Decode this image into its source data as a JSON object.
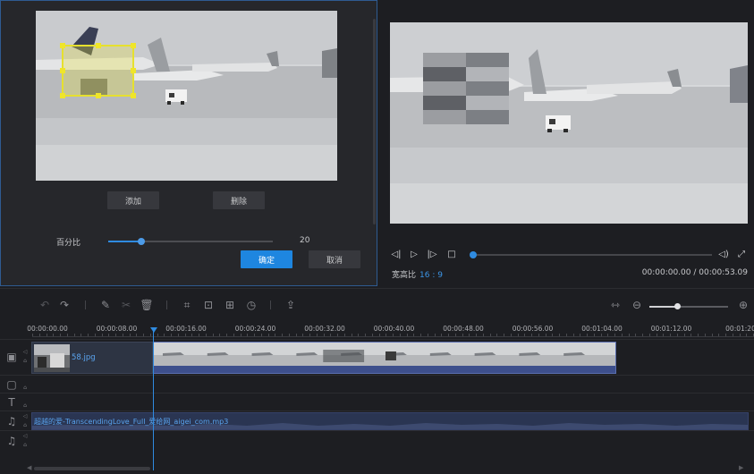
{
  "dialog": {
    "add_label": "添加",
    "delete_label": "删除",
    "percent_label": "百分比",
    "percent_value": "20",
    "percent_fraction": 0.2,
    "confirm_label": "确定",
    "cancel_label": "取消"
  },
  "player": {
    "aspect_label": "宽高比",
    "aspect_value": "16 : 9",
    "timecode": "00:00:00.00 / 00:00:53.09",
    "progress_fraction": 0.0
  },
  "timeline": {
    "ticks": [
      "00:00:00.00",
      "00:00:08.00",
      "00:00:16.00",
      "00:00:24.00",
      "00:00:32.00",
      "00:00:40.00",
      "00:00:48.00",
      "00:00:56.00",
      "00:01:04.00",
      "00:01:12.00",
      "00:01:20"
    ],
    "image_clip_name": "58.jpg",
    "audio_clip_name": "超越的爱-TranscendingLove_Full_爱给网_aigei_com.mp3",
    "zoom_fraction": 0.35
  },
  "icons": {
    "undo": "undo-icon",
    "redo": "redo-icon",
    "pen": "pen-icon",
    "cut": "scissors-icon",
    "delete": "trash-icon",
    "crop": "crop-icon",
    "mosaic": "mosaic-icon",
    "split": "split-icon",
    "speed": "clock-icon",
    "export": "export-icon"
  },
  "colors": {
    "accent": "#2f8be0",
    "mosaic_highlight": "#e6e02e",
    "video_clip": "#3d4f8c",
    "audio_clip": "#2a3552"
  }
}
